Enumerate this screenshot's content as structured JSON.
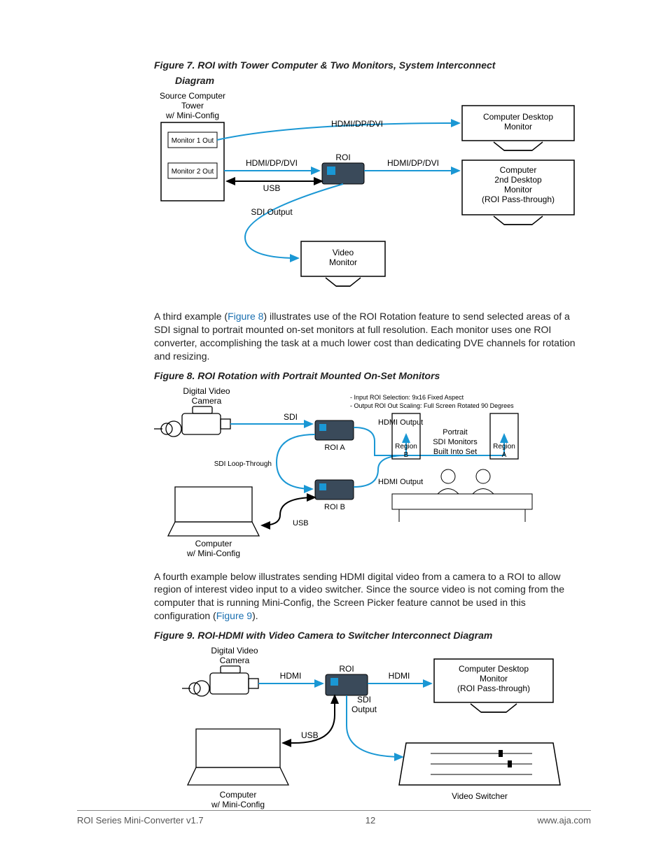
{
  "figures": {
    "f7": {
      "caption_line1": "Figure 7.  ROI with Tower Computer & Two Monitors, System Interconnect",
      "caption_line2": "Diagram",
      "source_label_line1": "Source Computer",
      "source_label_line2": "Tower",
      "source_label_line3": "w/ Mini-Config",
      "mon1_out": "Monitor 1 Out",
      "mon2_out": "Monitor 2 Out",
      "hdmi_dp_dvi": "HDMI/DP/DVI",
      "roi": "ROI",
      "usb": "USB",
      "sdi_output": "SDI Output",
      "video_monitor_line1": "Video",
      "video_monitor_line2": "Monitor",
      "desktop_mon_line1": "Computer Desktop",
      "desktop_mon_line2": "Monitor",
      "second_mon_line1": "Computer",
      "second_mon_line2": "2nd Desktop",
      "second_mon_line3": "Monitor",
      "second_mon_line4": "(ROI Pass-through)"
    },
    "f8": {
      "caption": "Figure 8.  ROI Rotation with Portrait Mounted On-Set Monitors",
      "camera_line1": "Digital Video",
      "camera_line2": "Camera",
      "sdi": "SDI",
      "sdi_loop": "SDI Loop-Through",
      "hdmi_output": "HDMI Output",
      "roi_a": "ROI A",
      "roi_b": "ROI B",
      "usb": "USB",
      "computer_line1": "Computer",
      "computer_line2": "w/ Mini-Config",
      "region_a": "Region\nA",
      "region_b": "Region\nB",
      "portrait_line1": "Portrait",
      "portrait_line2": "SDI Monitors",
      "portrait_line3": "Built Into Set",
      "note_line1": "- Input ROI Selection: 9x16 Fixed Aspect",
      "note_line2": "- Output ROI Out Scaling: Full Screen Rotated 90 Degrees"
    },
    "f9": {
      "caption": "Figure 9.  ROI-HDMI with Video Camera to Switcher Interconnect Diagram",
      "camera_line1": "Digital Video",
      "camera_line2": "Camera",
      "hdmi": "HDMI",
      "roi": "ROI",
      "sdi_line1": "SDI",
      "sdi_line2": "Output",
      "usb": "USB",
      "computer_line1": "Computer",
      "computer_line2": "w/ Mini-Config",
      "desktop_mon_line1": "Computer Desktop",
      "desktop_mon_line2": "Monitor",
      "desktop_mon_line3": "(ROI Pass-through)",
      "video_switcher": "Video Switcher"
    }
  },
  "paragraphs": {
    "p1_a": "A third example (",
    "p1_link": "Figure 8",
    "p1_b": ") illustrates use of the ROI Rotation feature to send selected areas of a SDI signal to portrait mounted on-set monitors at full resolution. Each monitor uses one ROI converter, accomplishing the task at a much lower cost than dedicating DVE channels for rotation and resizing.",
    "p2_a": "A fourth example below illustrates sending HDMI digital video from a camera to a ROI to allow region of interest video input to a video switcher. Since the source video is not coming from the computer that is running Mini-Config, the Screen Picker feature cannot be used in this configuration (",
    "p2_link": "Figure 9",
    "p2_b": ")."
  },
  "footer": {
    "left": "ROI Series Mini-Converter v1.7",
    "center": "12",
    "right": "www.aja.com"
  },
  "colors": {
    "signal_blue": "#1a97d4",
    "signal_black": "#000000"
  }
}
